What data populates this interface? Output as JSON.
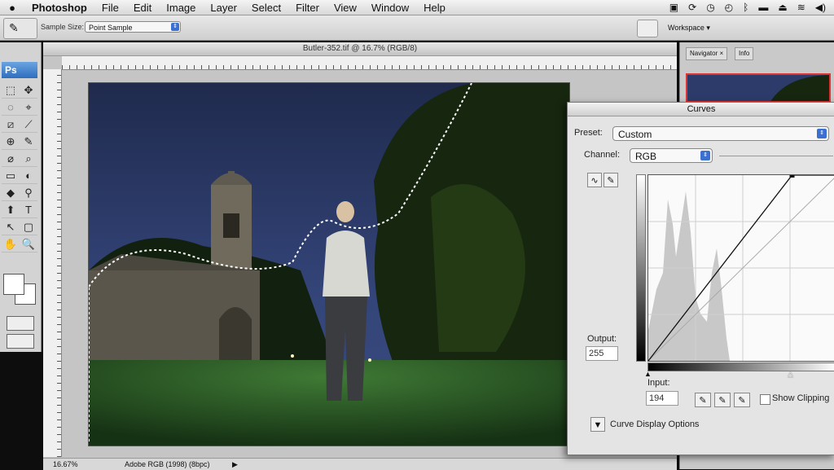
{
  "menubar": {
    "apple": "",
    "app": "Photoshop",
    "items": [
      "File",
      "Edit",
      "Image",
      "Layer",
      "Select",
      "Filter",
      "View",
      "Window",
      "Help"
    ]
  },
  "options": {
    "sample_label": "Sample Size:",
    "sample_value": "Point Sample",
    "workspace": "Workspace ▾"
  },
  "tools": {
    "ps_label": "Ps",
    "items": [
      "⬚",
      "✥",
      "◌",
      "⌖",
      "⧄",
      "⟋",
      "⊕",
      "✎",
      "⌀",
      "⌕",
      "▭",
      "◐",
      "◆",
      "⚲",
      "⬆",
      "T",
      "↖",
      "▢",
      "✋",
      "🔍"
    ]
  },
  "document": {
    "title": "Butler-352.tif @ 16.7% (RGB/8)",
    "zoom": "16.67%",
    "profile": "Adobe RGB (1998) (8bpc)"
  },
  "panels": {
    "tab_navigator": "Navigator ×",
    "tab_info": "Info"
  },
  "curves": {
    "title": "Curves",
    "preset_label": "Preset:",
    "preset_value": "Custom",
    "channel_label": "Channel:",
    "channel_value": "RGB",
    "output_label": "Output:",
    "output_value": "255",
    "input_label": "Input:",
    "input_value": "194",
    "show_clipping": "Show Clipping",
    "display_options": "Curve Display Options",
    "point": {
      "input": 194,
      "output": 255
    }
  },
  "colors": {
    "accent": "#3b6fd0",
    "sky": "#2c3a63",
    "grass": "#2e5a2a"
  }
}
